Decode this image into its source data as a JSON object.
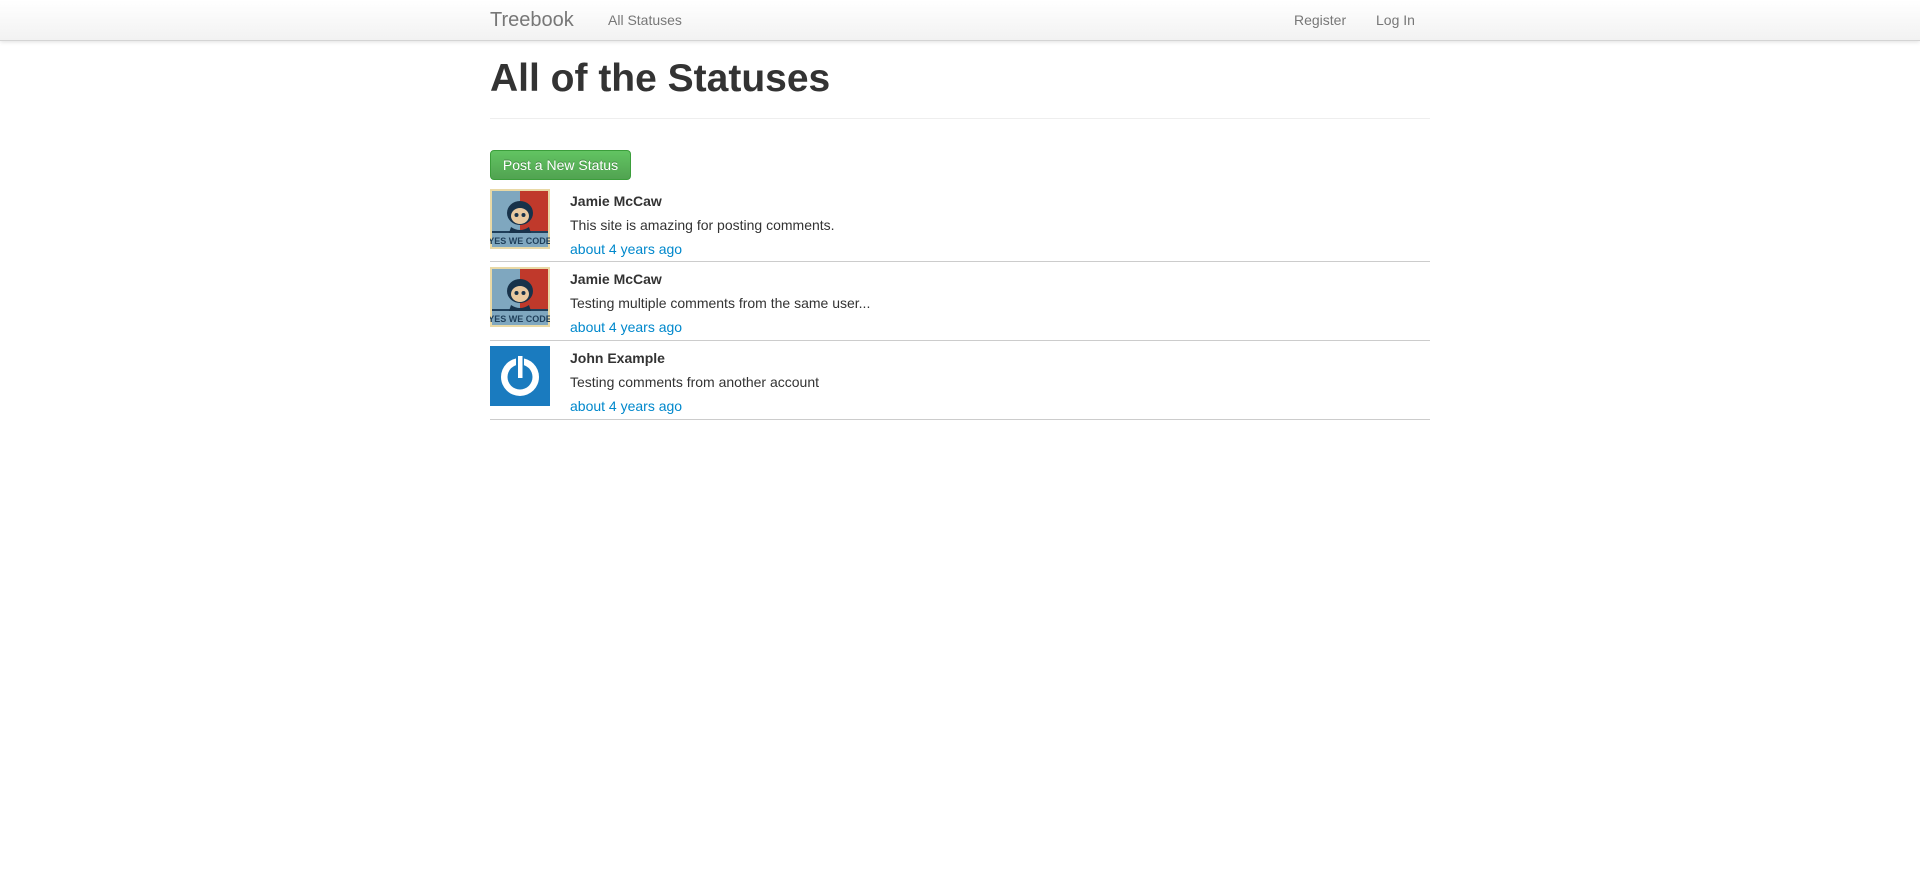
{
  "navbar": {
    "brand": "Treebook",
    "links": {
      "all_statuses": "All Statuses",
      "register": "Register",
      "login": "Log In"
    }
  },
  "page": {
    "title": "All of the Statuses",
    "new_status_button": "Post a New Status"
  },
  "statuses": [
    {
      "name": "Jamie McCaw",
      "content": "This site is amazing for posting comments.",
      "time": "about 4 years ago",
      "avatar_icon": "yes-we-code-octocat-avatar"
    },
    {
      "name": "Jamie McCaw",
      "content": "Testing multiple comments from the same user...",
      "time": "about 4 years ago",
      "avatar_icon": "yes-we-code-octocat-avatar"
    },
    {
      "name": "John Example",
      "content": "Testing comments from another account",
      "time": "about 4 years ago",
      "avatar_icon": "power-symbol-default-avatar"
    }
  ],
  "colors": {
    "link": "#0088cc",
    "button_green": "#5bb75b",
    "avatar_blue": "#1a7bbf"
  }
}
